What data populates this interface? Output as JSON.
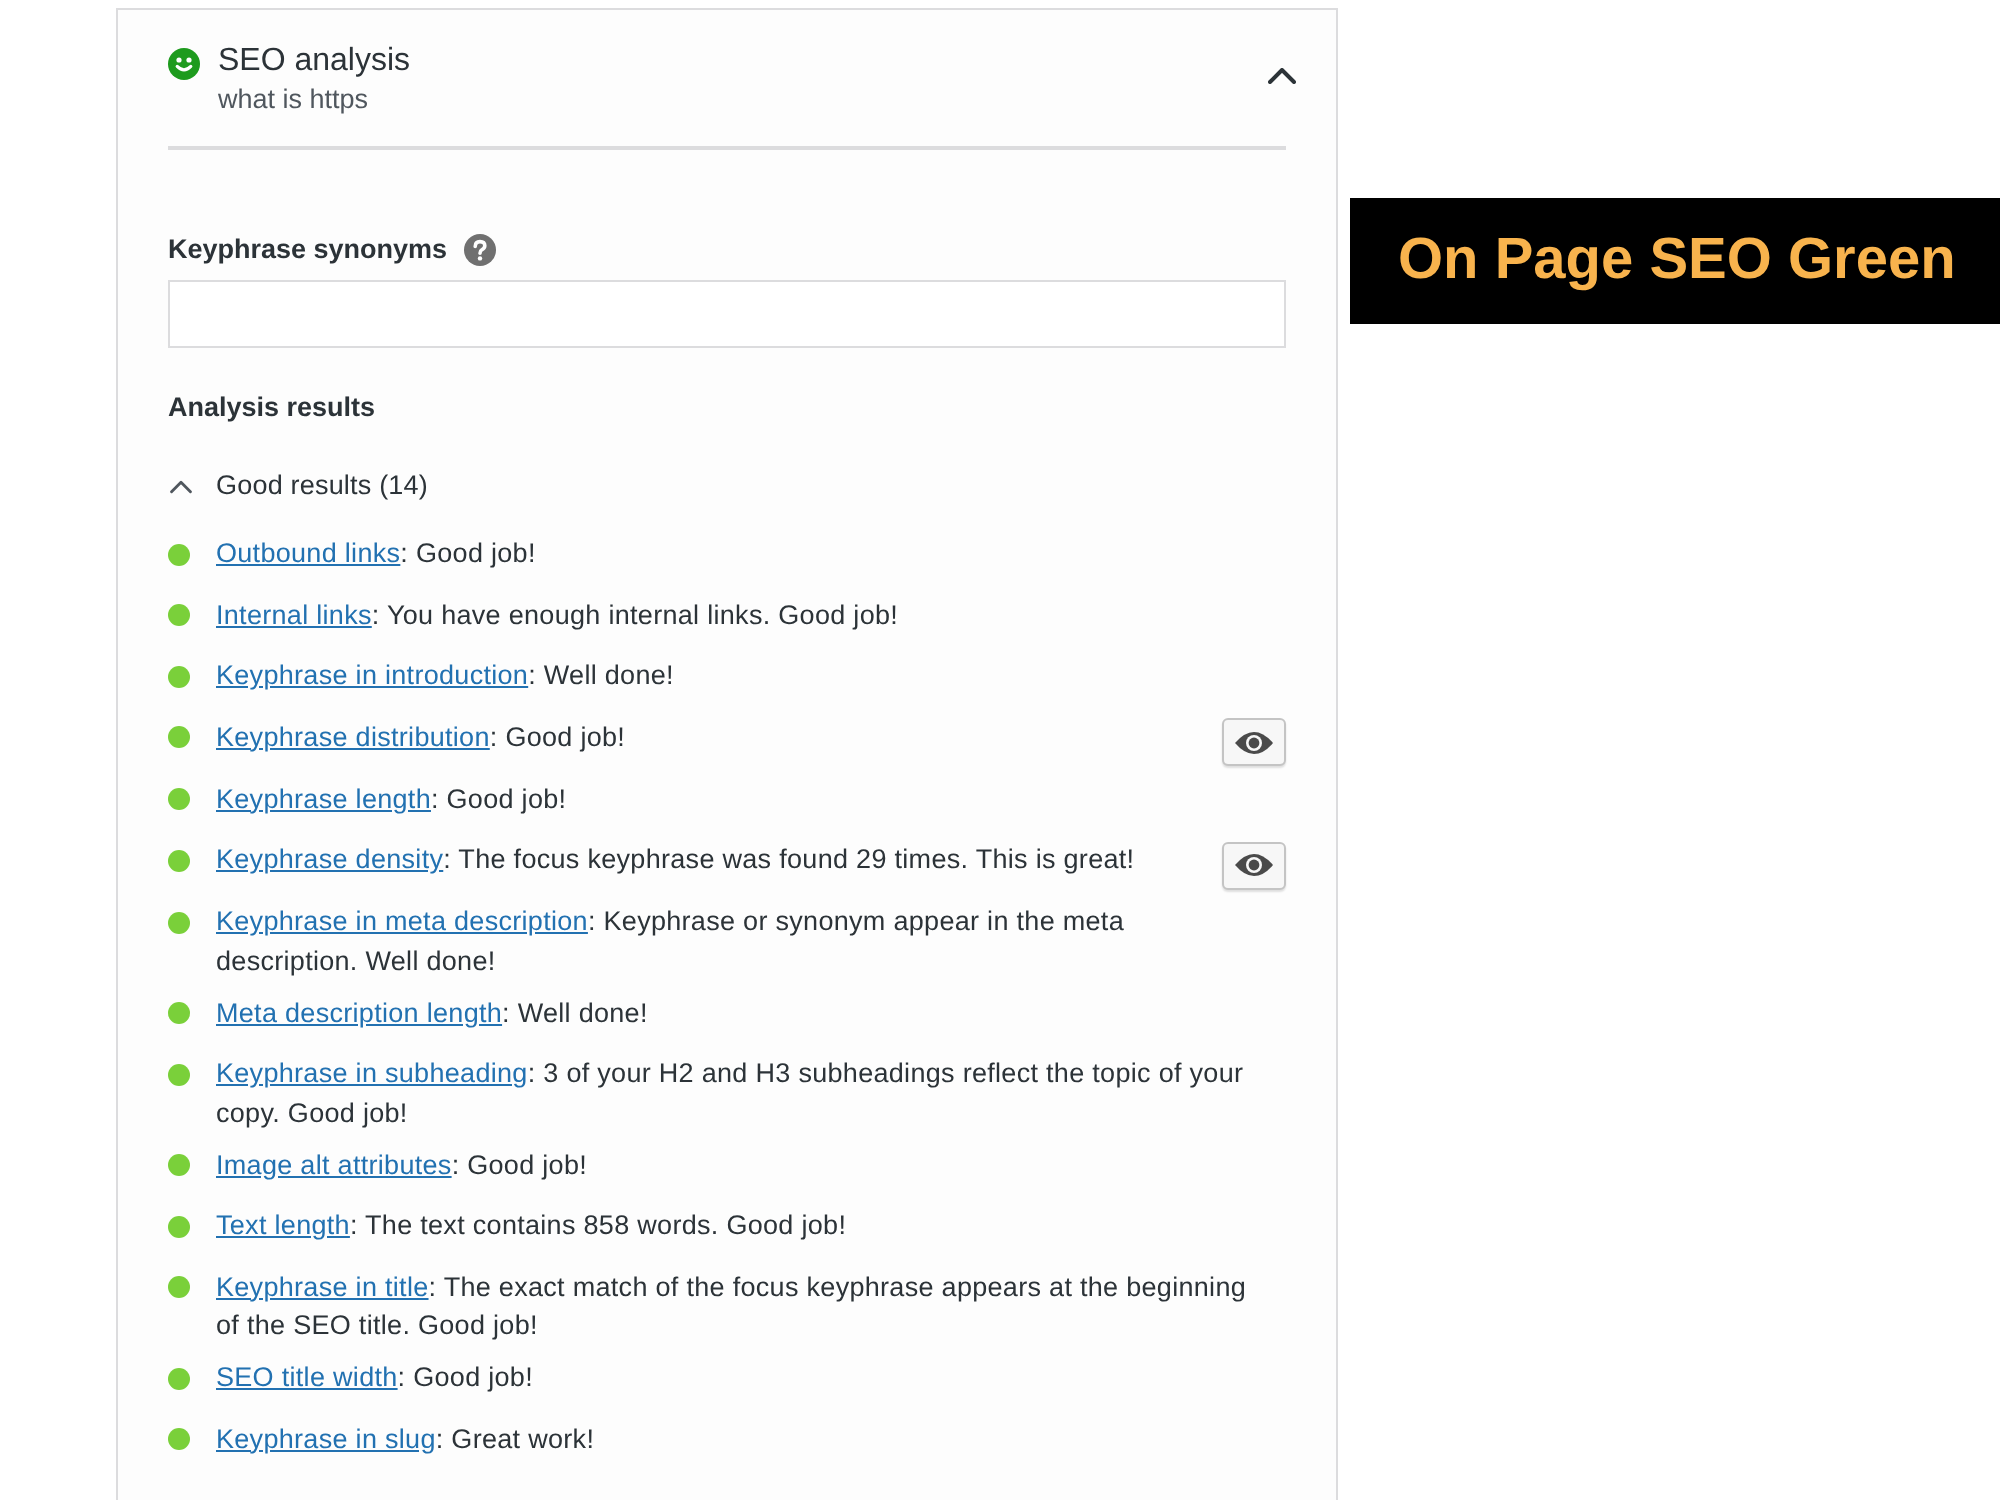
{
  "panel": {
    "title": "SEO analysis",
    "subtitle": "what is https",
    "expanded": true
  },
  "synonyms": {
    "label": "Keyphrase synonyms"
  },
  "analysis": {
    "heading": "Analysis results",
    "groups": [
      {
        "label": "Good results (14)",
        "expanded": true,
        "results": [
          {
            "link": "Outbound links",
            "text": ": Good job!",
            "highlight_button": false
          },
          {
            "link": "Internal links",
            "text": ": You have enough internal links. Good job!",
            "highlight_button": false
          },
          {
            "link": "Keyphrase in introduction",
            "text": ": Well done!",
            "highlight_button": false
          },
          {
            "link": "Keyphrase distribution",
            "text": ": Good job!",
            "highlight_button": true
          },
          {
            "link": "Keyphrase length",
            "text": ": Good job!",
            "highlight_button": false
          },
          {
            "link": "Keyphrase density",
            "text": ": The focus keyphrase was found 29 times. This is great!",
            "highlight_button": true
          },
          {
            "link": "Keyphrase in meta description",
            "text": ": Keyphrase or synonym appear in the meta description. Well done!",
            "highlight_button": false
          },
          {
            "link": "Meta description length",
            "text": ": Well done!",
            "highlight_button": false
          },
          {
            "link": "Keyphrase in subheading",
            "text": ": 3 of your H2 and H3 subheadings reflect the topic of your copy. Good job!",
            "highlight_button": false
          },
          {
            "link": "Image alt attributes",
            "text": ": Good job!",
            "highlight_button": false
          },
          {
            "link": "Text length",
            "text": ": The text contains 858 words. Good job!",
            "highlight_button": false
          },
          {
            "link": "Keyphrase in title",
            "text": ": The exact match of the focus keyphrase appears at the beginning of the SEO title. Good job!",
            "highlight_button": false
          },
          {
            "link": "SEO title width",
            "text": ": Good job!",
            "highlight_button": false
          },
          {
            "link": "Keyphrase in slug",
            "text": ": Great work!",
            "highlight_button": false
          }
        ]
      }
    ]
  },
  "banner": {
    "text": "On Page SEO Green"
  }
}
